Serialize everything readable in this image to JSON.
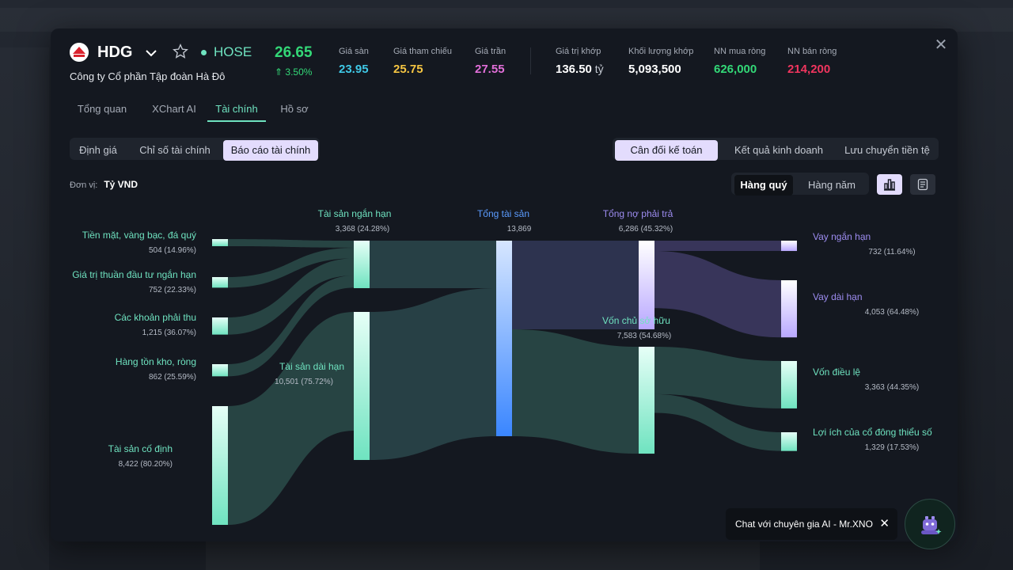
{
  "header": {
    "ticker": "HDG",
    "exchange": "HOSE",
    "company": "Công ty Cổ phần Tập đoàn Hà Đô",
    "price": "26.65",
    "change_pct": "3.50%",
    "stats": [
      {
        "label": "Giá sàn",
        "value": "23.95",
        "color": "#3fc8e6"
      },
      {
        "label": "Giá tham chiếu",
        "value": "25.75",
        "color": "#f5c542"
      },
      {
        "label": "Giá trần",
        "value": "27.55",
        "color": "#e26fd9"
      },
      {
        "label": "Giá trị khớp",
        "value": "136.50",
        "unit": "tỷ",
        "color": "#ffffff"
      },
      {
        "label": "Khối lượng khớp",
        "value": "5,093,500",
        "color": "#ffffff"
      },
      {
        "label": "NN mua ròng",
        "value": "626,000",
        "color": "#33d877"
      },
      {
        "label": "NN bán ròng",
        "value": "214,200",
        "color": "#f0355e"
      }
    ]
  },
  "main_tabs": [
    "Tổng quan",
    "XChart AI",
    "Tài chính",
    "Hồ sơ"
  ],
  "sub_tabs": [
    "Định giá",
    "Chỉ số tài chính",
    "Báo cáo tài chính"
  ],
  "report_tabs": [
    "Cân đối kế toán",
    "Kết quả kinh doanh",
    "Lưu chuyển tiền tệ"
  ],
  "unit": {
    "label": "Đơn vị:",
    "value": "Tỷ VND"
  },
  "period_tabs": [
    "Hàng quý",
    "Hàng năm"
  ],
  "icons": {
    "chart": "bar-chart-icon",
    "table": "report-icon",
    "close": "close-icon",
    "star": "star-icon",
    "chevron": "chevron-down-icon",
    "bot": "robot-icon"
  },
  "colors": {
    "green": "#6fe3c0",
    "blue": "#3a86ff",
    "purple": "#b9a8ff",
    "accent": "#e3dcfd"
  },
  "chart_data": {
    "type": "sankey",
    "nodes": [
      {
        "id": "cash",
        "name": "Tiền mặt, vàng bạc, đá quý",
        "value": 504,
        "pct": "14.96%"
      },
      {
        "id": "stinv",
        "name": "Giá trị thuần đầu tư ngắn hạn",
        "value": 752,
        "pct": "22.33%"
      },
      {
        "id": "recv",
        "name": "Các khoản phải thu",
        "value": 1215,
        "pct": "36.07%"
      },
      {
        "id": "inv",
        "name": "Hàng tồn kho, ròng",
        "value": 862,
        "pct": "25.59%"
      },
      {
        "id": "fixed",
        "name": "Tài sản cố định",
        "value": 8422,
        "pct": "80.20%"
      },
      {
        "id": "cur",
        "name": "Tài sản ngắn hạn",
        "value": 3368,
        "pct": "24.28%"
      },
      {
        "id": "lt",
        "name": "Tài sản dài hạn",
        "value": 10501,
        "pct": "75.72%"
      },
      {
        "id": "total",
        "name": "Tổng tài sản",
        "value": 13869,
        "pct": ""
      },
      {
        "id": "liab",
        "name": "Tổng nợ phải trả",
        "value": 6286,
        "pct": "45.32%"
      },
      {
        "id": "eq",
        "name": "Vốn chủ sở hữu",
        "value": 7583,
        "pct": "54.68%"
      },
      {
        "id": "stloan",
        "name": "Vay ngắn hạn",
        "value": 732,
        "pct": "11.64%"
      },
      {
        "id": "ltloan",
        "name": "Vay dài hạn",
        "value": 4053,
        "pct": "64.48%"
      },
      {
        "id": "charter",
        "name": "Vốn điều lệ",
        "value": 3363,
        "pct": "44.35%"
      },
      {
        "id": "minor",
        "name": "Lợi ích của cổ đông thiểu số",
        "value": 1329,
        "pct": "17.53%"
      }
    ],
    "links": [
      {
        "source": "cash",
        "target": "cur",
        "value": 504
      },
      {
        "source": "stinv",
        "target": "cur",
        "value": 752
      },
      {
        "source": "recv",
        "target": "cur",
        "value": 1215
      },
      {
        "source": "inv",
        "target": "cur",
        "value": 862
      },
      {
        "source": "fixed",
        "target": "lt",
        "value": 8422
      },
      {
        "source": "cur",
        "target": "total",
        "value": 3368
      },
      {
        "source": "lt",
        "target": "total",
        "value": 10501
      },
      {
        "source": "total",
        "target": "liab",
        "value": 6286
      },
      {
        "source": "total",
        "target": "eq",
        "value": 7583
      },
      {
        "source": "liab",
        "target": "stloan",
        "value": 732
      },
      {
        "source": "liab",
        "target": "ltloan",
        "value": 4053
      },
      {
        "source": "eq",
        "target": "charter",
        "value": 3363
      },
      {
        "source": "eq",
        "target": "minor",
        "value": 1329
      }
    ]
  },
  "chat": {
    "label": "Chat với chuyên gia AI - Mr.XNO"
  }
}
